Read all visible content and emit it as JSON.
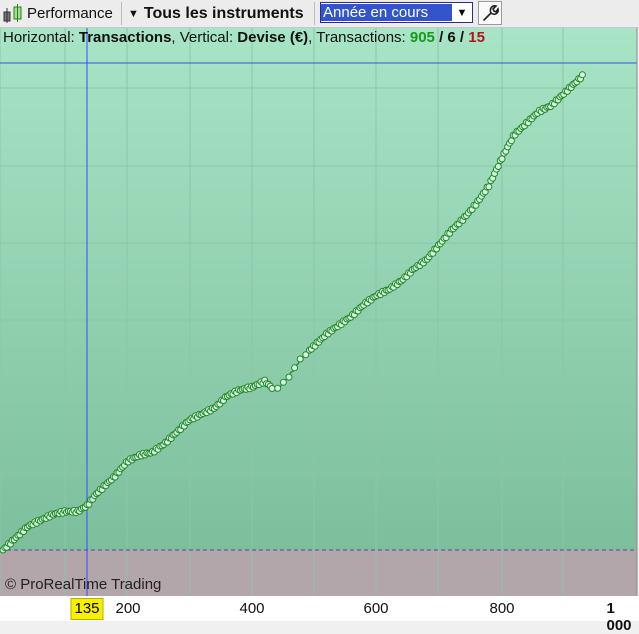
{
  "toolbar": {
    "performance_label": "Performance",
    "instruments_label": "Tous les instruments",
    "period_select": "Année en cours"
  },
  "info": {
    "horizontal_prefix": "Horizontal: ",
    "horizontal_value": "Transactions",
    "vertical_prefix": ", Vertical: ",
    "vertical_value": "Devise (€)",
    "transactions_prefix": ", Transactions: ",
    "count_total": "905",
    "slash1": " / ",
    "count_neutral": "6",
    "slash2": " / ",
    "count_losing": "15"
  },
  "copyright": "© ProRealTime Trading",
  "colors": {
    "plot_bg_top": "#a8e4c6",
    "plot_bg_bottom": "#7dbf9c",
    "negative_zone": "#b2a6aa",
    "curve": "#1f8a2a",
    "crosshair": "#3050ff",
    "zero_line": "#6040a0",
    "loss_segment": "#c02020"
  },
  "chart_data": {
    "type": "line",
    "xlabel": "Transactions",
    "ylabel": "Devise (€)",
    "xlim": [
      0,
      1000
    ],
    "x_ticks": [
      "200",
      "400",
      "600",
      "800",
      "1 000"
    ],
    "cursor_x_label": "135",
    "x": [
      0,
      10,
      25,
      40,
      60,
      80,
      100,
      120,
      135,
      150,
      180,
      200,
      220,
      240,
      260,
      280,
      300,
      320,
      340,
      360,
      380,
      400,
      420,
      430,
      440,
      460,
      480,
      500,
      520,
      540,
      560,
      580,
      600,
      620,
      640,
      660,
      680,
      700,
      720,
      740,
      760,
      780,
      800,
      820,
      840,
      860,
      880,
      900,
      920,
      930
    ],
    "y": [
      0,
      0.02,
      0.05,
      0.08,
      0.1,
      0.12,
      0.13,
      0.13,
      0.15,
      0.19,
      0.25,
      0.3,
      0.32,
      0.33,
      0.36,
      0.4,
      0.44,
      0.46,
      0.48,
      0.52,
      0.54,
      0.55,
      0.57,
      0.55,
      0.54,
      0.59,
      0.65,
      0.69,
      0.73,
      0.76,
      0.79,
      0.83,
      0.86,
      0.88,
      0.91,
      0.95,
      0.98,
      1.03,
      1.08,
      1.12,
      1.17,
      1.23,
      1.32,
      1.4,
      1.44,
      1.48,
      1.5,
      1.54,
      1.58,
      1.6
    ],
    "markers": "open-circle",
    "grid": true
  }
}
